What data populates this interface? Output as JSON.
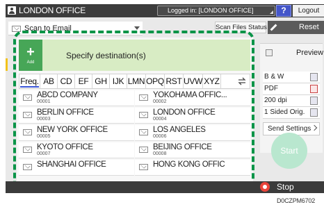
{
  "topbar": {
    "title": "LONDON OFFICE",
    "login_status": "Logged in: [LONDON OFFICE]",
    "help_label": "?",
    "logout_label": "Logout"
  },
  "scan_mode": {
    "selected": "Scan to Email"
  },
  "scan_files_status_label": "Scan Files Status",
  "reset_label": "Reset",
  "destination": {
    "add_label": "Add",
    "add_symbol": "+",
    "specify_label": "Specify destination(s)",
    "tabs": [
      "Freq.",
      "AB",
      "CD",
      "EF",
      "GH",
      "IJK",
      "LMN",
      "OPQ",
      "RST",
      "UVW",
      "XYZ"
    ],
    "active_tab": "Freq.",
    "entries": [
      {
        "name": "ABCD COMPANY",
        "id": "00001"
      },
      {
        "name": "YOKOHAMA OFFIC...",
        "id": "00002"
      },
      {
        "name": "BERLIN OFFICE",
        "id": "00003"
      },
      {
        "name": "LONDON OFFICE",
        "id": "00004"
      },
      {
        "name": "NEW YORK OFFICE",
        "id": "00005"
      },
      {
        "name": "LOS ANGELES",
        "id": "00006"
      },
      {
        "name": "KYOTO OFFICE",
        "id": "00007"
      },
      {
        "name": "BEIJING OFFICE",
        "id": "00008"
      },
      {
        "name": "SHANGHAI OFFICE",
        "id": ""
      },
      {
        "name": "HONG KONG OFFIC",
        "id": ""
      }
    ]
  },
  "settings": {
    "preview_label": "Preview",
    "color_mode": "B & W",
    "file_type": "PDF",
    "resolution": "200 dpi",
    "sides": "1 Sided Orig.",
    "send_settings_label": "Send Settings"
  },
  "start_label": "Start",
  "stop_label": "Stop",
  "figure_code": "D0CZPM6702",
  "colors": {
    "highlight_border": "#0a9448",
    "add_button": "#47a657",
    "specify_bg": "#d8ecc4",
    "help_button": "#4456c9",
    "start_button": "#b9e7cf",
    "stop_icon": "#e9443a"
  }
}
